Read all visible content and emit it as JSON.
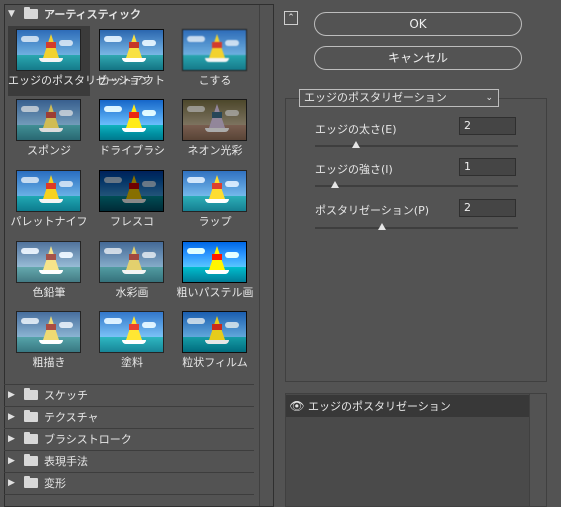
{
  "categories": {
    "artistic": {
      "label": "アーティスティック",
      "expanded": true
    },
    "collapsed": [
      {
        "label": "スケッチ"
      },
      {
        "label": "テクスチャ"
      },
      {
        "label": "ブラシストローク"
      },
      {
        "label": "表現手法"
      },
      {
        "label": "変形"
      }
    ]
  },
  "filters": [
    {
      "label": "エッジのポスタリゼーション",
      "selected": true
    },
    {
      "label": "カットアウト"
    },
    {
      "label": "こする"
    },
    {
      "label": "スポンジ"
    },
    {
      "label": "ドライブラシ"
    },
    {
      "label": "ネオン光彩"
    },
    {
      "label": "パレットナイフ"
    },
    {
      "label": "フレスコ"
    },
    {
      "label": "ラップ"
    },
    {
      "label": "色鉛筆"
    },
    {
      "label": "水彩画"
    },
    {
      "label": "粗いパステル画"
    },
    {
      "label": "粗描き"
    },
    {
      "label": "塗料"
    },
    {
      "label": "粒状フィルム"
    }
  ],
  "buttons": {
    "ok": "OK",
    "cancel": "キャンセル"
  },
  "settings": {
    "selected_filter": "エッジのポスタリゼーション",
    "params": [
      {
        "label": "エッジの太さ(E)",
        "value": "2",
        "slider_fraction": 0.2
      },
      {
        "label": "エッジの強さ(I)",
        "value": "1",
        "slider_fraction": 0.1
      },
      {
        "label": "ポスタリゼーション(P)",
        "value": "2",
        "slider_fraction": 0.33
      }
    ]
  },
  "layers": [
    {
      "name": "エッジのポスタリゼーション",
      "visible": true
    }
  ],
  "icons": {
    "collapse": "collapse-up-icon",
    "folder": "folder-icon",
    "eye": "eye-icon",
    "chevron": "chevron-down-icon"
  }
}
